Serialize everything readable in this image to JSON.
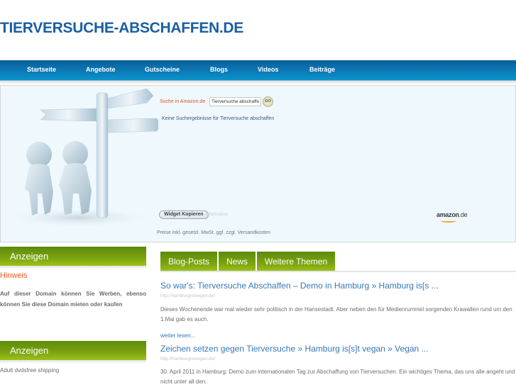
{
  "header": {
    "site_title": "TIERVERSUCHE-ABSCHAFFEN.DE"
  },
  "nav": {
    "items": [
      {
        "label": "Startseite"
      },
      {
        "label": "Angebote"
      },
      {
        "label": "Gutscheine"
      },
      {
        "label": "Blogs"
      },
      {
        "label": "Videos"
      },
      {
        "label": "Beiträge"
      }
    ]
  },
  "amazon_widget": {
    "search_label": "Suche in Amazon.de",
    "search_value": "Tierversuche abschaffen",
    "go_label": "GO",
    "no_results": "Keine Suchergebnisse für Tierversuche abschaffen",
    "copy_button": "Widget Kopieren",
    "info_link": "Information",
    "price_note": "Preise inkl. gesetzl. MwSt. ggf. zzgl. Versandkosten",
    "logo_text": "amazon",
    "logo_tld": ".de",
    "colors": {
      "label": "#e8502a",
      "smile": "#f0a13a"
    }
  },
  "sidebar": {
    "sections": [
      {
        "heading": "Anzeigen",
        "subheading": "Hinweis",
        "text": "Auf dieser Domain können Sie Werben, ebenso können Sie diese Domain mieten oder kaufen"
      },
      {
        "heading": "Anzeigen",
        "text": "Adult dvdsfree shipping"
      }
    ]
  },
  "main": {
    "tabs": [
      {
        "label": "Blog-Posts"
      },
      {
        "label": "News"
      },
      {
        "label": "Weitere Themen"
      }
    ],
    "posts": [
      {
        "title": "So war's: Tierversuche Abschaffen – Demo in Hamburg » Hamburg is[s ...",
        "url": "http://hamburgistvegan.de/",
        "excerpt": "Dieses Wochenende war mal wieder sehr politisch in der Hansestadt. Aber neben den für Medienrummel sorgenden Krawallen rund um den 1.Mai gab es auch.",
        "read_more": "weiter lesen..."
      },
      {
        "title": "Zeichen setzen gegen Tierversuche » Hamburg is[s]t vegan » Vegan ...",
        "url": "http://hamburgistvegan.de/",
        "excerpt": "30. April 2011 in Hamburg: Demo zum internationalen Tag zur Abschaffung von Tierversuchen. Ein wichtiges Thema, das uns alle angeht und nicht unter all den."
      }
    ]
  },
  "theme": {
    "brand_blue": "#1a5fa3",
    "nav_blue": "#0c7ab8",
    "accent_green": "#7aa410",
    "link_blue": "#3679b8",
    "alert_orange": "#f25a22"
  }
}
